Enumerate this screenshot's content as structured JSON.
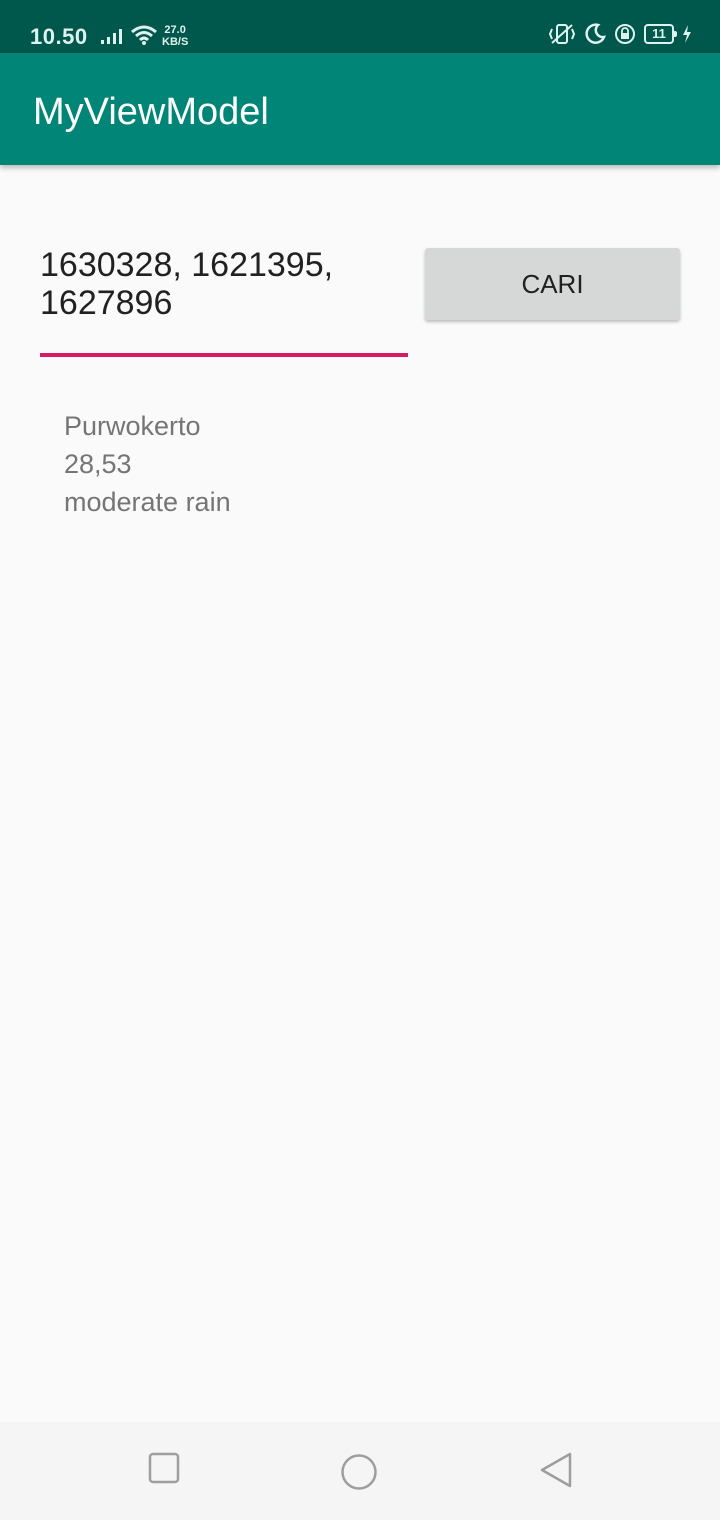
{
  "status_bar": {
    "time": "10.50",
    "network_speed_value": "27.0",
    "network_speed_unit": "KB/S",
    "battery_level": "11",
    "icons": [
      "signal-icon",
      "wifi-icon",
      "vibrate-icon",
      "moon-icon",
      "lock-rotation-icon",
      "battery-icon",
      "charging-icon"
    ]
  },
  "app_bar": {
    "title": "MyViewModel",
    "color": "#008577"
  },
  "search": {
    "input_value": "1630328, 1621395, 1627896",
    "underline_color": "#d81b60",
    "button_label": "CARI"
  },
  "result": {
    "city": "Purwokerto",
    "temperature": "28,53",
    "description": "moderate rain"
  },
  "nav_bar": {
    "icons": [
      "recent-apps-icon",
      "home-icon",
      "back-icon"
    ]
  }
}
